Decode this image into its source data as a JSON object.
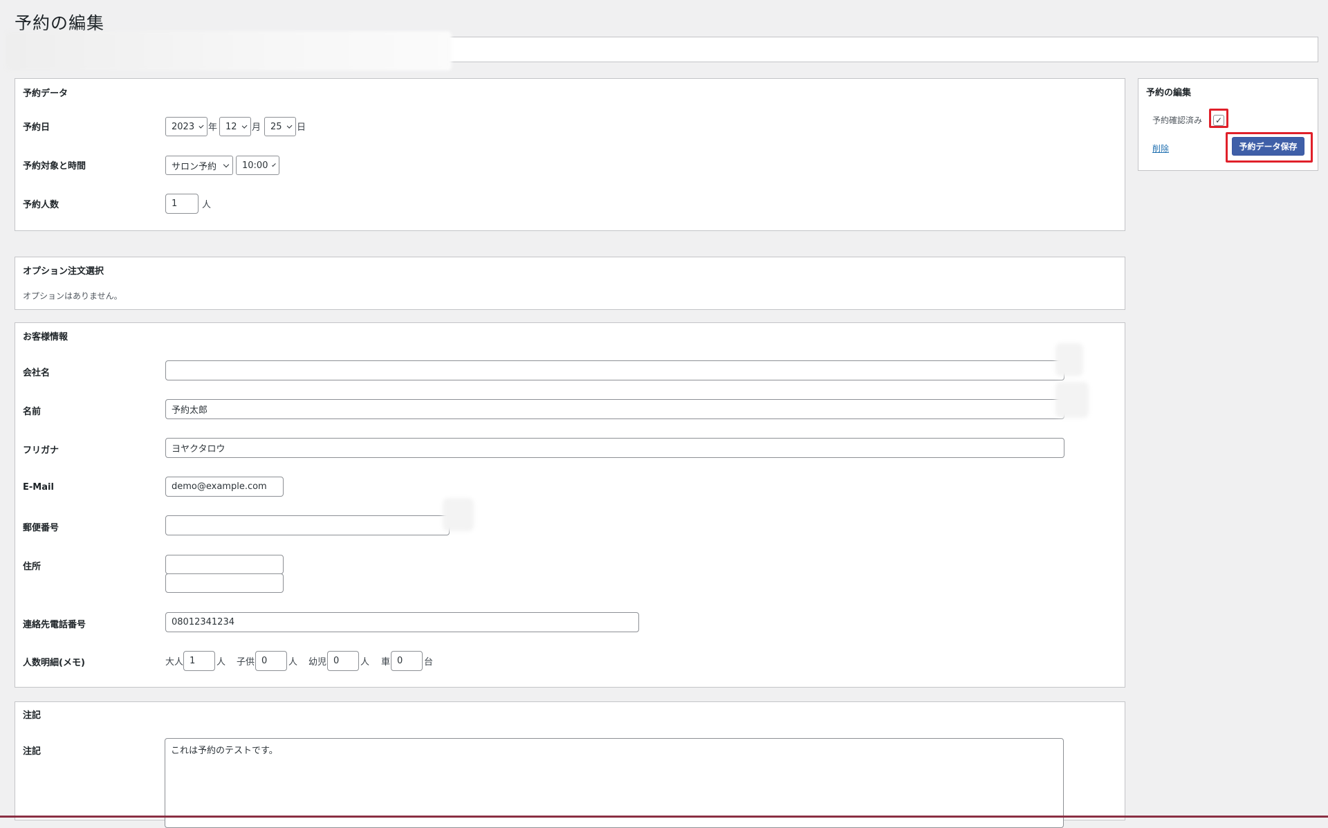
{
  "page": {
    "title": "予約の編集"
  },
  "reservation": {
    "heading": "予約データ",
    "date": {
      "label": "予約日",
      "year": "2023",
      "year_unit": "年",
      "month": "12",
      "month_unit": "月",
      "day": "25",
      "day_unit": "日"
    },
    "target_time": {
      "label": "予約対象と時間",
      "target": "サロン予約",
      "time": "10:00"
    },
    "people": {
      "label": "予約人数",
      "value": "1",
      "unit": "人"
    }
  },
  "options": {
    "heading": "オプション注文選択",
    "empty_text": "オプションはありません。"
  },
  "customer": {
    "heading": "お客様情報",
    "company": {
      "label": "会社名",
      "value": ""
    },
    "name": {
      "label": "名前",
      "value": "予約太郎"
    },
    "kana": {
      "label": "フリガナ",
      "value": "ヨヤクタロウ"
    },
    "email": {
      "label": "E-Mail",
      "value": "demo@example.com"
    },
    "postal": {
      "label": "郵便番号",
      "value": ""
    },
    "address": {
      "label": "住所",
      "line1": "",
      "line2": ""
    },
    "phone": {
      "label": "連絡先電話番号",
      "value": "08012341234"
    },
    "breakdown": {
      "label": "人数明細(メモ)",
      "adult_label": "大人",
      "adult": "1",
      "adult_unit": "人",
      "child_label": "子供",
      "child": "0",
      "child_unit": "人",
      "infant_label": "幼児",
      "infant": "0",
      "infant_unit": "人",
      "car_label": "車",
      "car": "0",
      "car_unit": "台"
    }
  },
  "notes": {
    "heading": "注記",
    "label": "注記",
    "value": "これは予約のテストです。"
  },
  "sidebar": {
    "heading": "予約の編集",
    "confirmed_label": "予約確認済み",
    "confirmed_checked": true,
    "check_mark": "✓",
    "delete_label": "削除",
    "save_label": "予約データ保存"
  },
  "colors": {
    "primary": "#3f5fa8",
    "highlight": "#e0202a",
    "link": "#2271b1"
  }
}
